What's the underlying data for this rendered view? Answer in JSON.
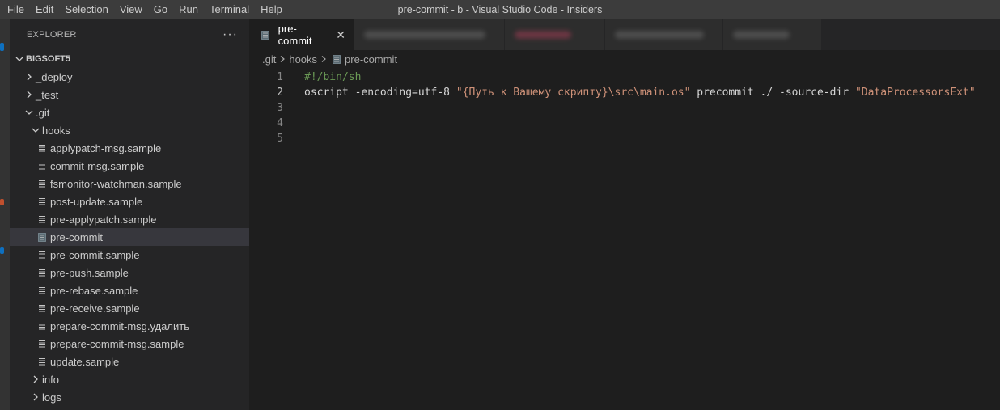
{
  "menu": [
    "File",
    "Edit",
    "Selection",
    "View",
    "Go",
    "Run",
    "Terminal",
    "Help"
  ],
  "window_title": "pre-commit - b       - Visual Studio Code - Insiders",
  "explorer": {
    "header": "EXPLORER",
    "more": "···",
    "root": "BIGSOFT5",
    "items": [
      {
        "label": "_deploy",
        "type": "folder",
        "expanded": false
      },
      {
        "label": "_test",
        "type": "folder",
        "expanded": false
      },
      {
        "label": ".git",
        "type": "folder",
        "expanded": true
      },
      {
        "label": "hooks",
        "type": "folder",
        "expanded": true
      },
      {
        "label": "applypatch-msg.sample",
        "type": "file"
      },
      {
        "label": "commit-msg.sample",
        "type": "file"
      },
      {
        "label": "fsmonitor-watchman.sample",
        "type": "file"
      },
      {
        "label": "post-update.sample",
        "type": "file"
      },
      {
        "label": "pre-applypatch.sample",
        "type": "file"
      },
      {
        "label": "pre-commit",
        "type": "file",
        "selected": true
      },
      {
        "label": "pre-commit.sample",
        "type": "file"
      },
      {
        "label": "pre-push.sample",
        "type": "file"
      },
      {
        "label": "pre-rebase.sample",
        "type": "file"
      },
      {
        "label": "pre-receive.sample",
        "type": "file"
      },
      {
        "label": "prepare-commit-msg.удалить",
        "type": "file"
      },
      {
        "label": "prepare-commit-msg.sample",
        "type": "file"
      },
      {
        "label": "update.sample",
        "type": "file"
      },
      {
        "label": "info",
        "type": "folder",
        "expanded": false
      },
      {
        "label": "logs",
        "type": "folder",
        "expanded": false
      }
    ]
  },
  "tabs": {
    "active_label": "pre-commit",
    "close": "✕"
  },
  "breadcrumb": [
    ".git",
    "hooks",
    "pre-commit"
  ],
  "code": {
    "line_numbers": [
      "1",
      "2",
      "3",
      "4",
      "5"
    ],
    "line1": "#!/bin/sh",
    "line2_a": "oscript -encoding=utf-8 ",
    "line2_b": "\"{Путь к Вашему скрипту}\\src\\main.os\"",
    "line2_c": " precommit ./ -source-dir ",
    "line2_d": "\"DataProcessorsExt\""
  },
  "colors": {
    "titlebar": "#3c3c3c",
    "sidebar": "#252526",
    "editor": "#1e1e1e",
    "selection": "#37373d",
    "string": "#ce9178",
    "comment": "#6a9955"
  }
}
